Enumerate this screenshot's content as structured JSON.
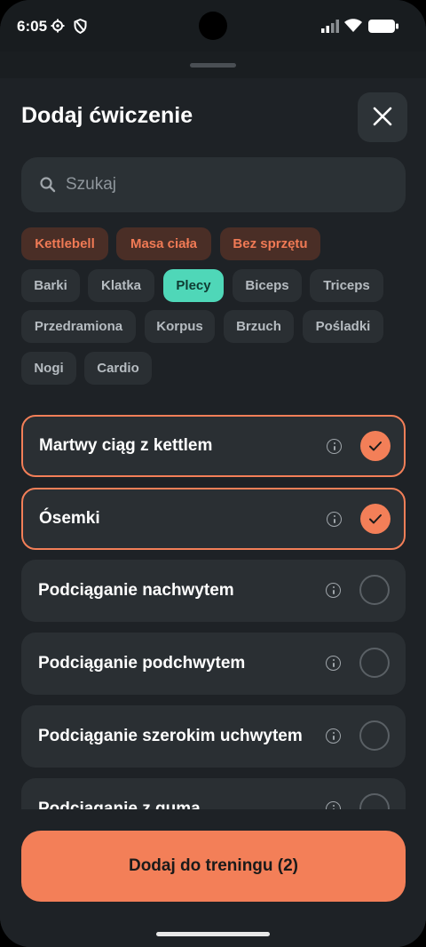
{
  "status_bar": {
    "time": "6:05"
  },
  "header": {
    "title": "Dodaj ćwiczenie"
  },
  "search": {
    "placeholder": "Szukaj"
  },
  "equipment_chips": [
    "Kettlebell",
    "Masa ciała",
    "Bez sprzętu"
  ],
  "muscle_chips": [
    "Barki",
    "Klatka",
    "Plecy",
    "Biceps",
    "Triceps",
    "Przedramiona",
    "Korpus",
    "Brzuch",
    "Pośladki",
    "Nogi",
    "Cardio"
  ],
  "selected_muscle": "Plecy",
  "exercises": [
    {
      "label": "Martwy ciąg z kettlem",
      "selected": true
    },
    {
      "label": "Ósemki",
      "selected": true
    },
    {
      "label": "Podciąganie nachwytem",
      "selected": false
    },
    {
      "label": "Podciąganie podchwytem",
      "selected": false
    },
    {
      "label": "Podciąganie szerokim uchwytem",
      "selected": false
    },
    {
      "label": "Podciąganie z gumą",
      "selected": false
    }
  ],
  "footer": {
    "add_label": "Dodaj do treningu (2)"
  },
  "colors": {
    "accent": "#f37f58",
    "selected_chip": "#4fd7b8",
    "background": "#1e2226",
    "card": "#2a2f33"
  }
}
